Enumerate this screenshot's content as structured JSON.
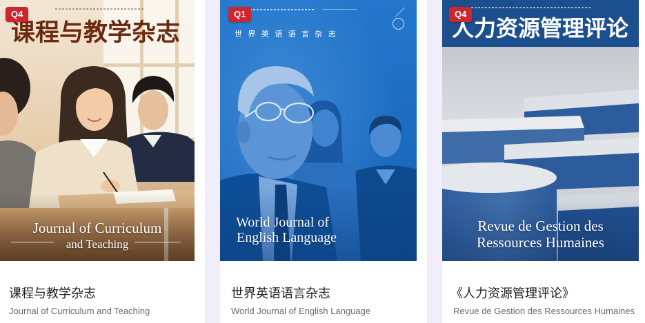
{
  "colors": {
    "page_background": "#efeefa",
    "card_background": "#ffffff",
    "badge_background": "#cc262f",
    "title_text": "#1f1f1f",
    "subtitle_text": "#6a6a6a"
  },
  "cards": [
    {
      "badge": "Q4",
      "cover": {
        "title_cn": "课程与教学杂志",
        "title_en_line1": "Journal of Curriculum",
        "title_en_line2": "and Teaching",
        "accent": "#6b2a0f"
      },
      "title": "课程与教学杂志",
      "subtitle": "Journal of Curriculum and Teaching"
    },
    {
      "badge": "Q1",
      "cover": {
        "title_cn": "世界英语语言杂志",
        "title_en_line1": "World Journal of",
        "title_en_line2": "English Language",
        "accent": "#1d6cc2"
      },
      "title": "世界英语语言杂志",
      "subtitle": "World Journal of English Language"
    },
    {
      "badge": "Q4",
      "cover": {
        "title_cn": "人力资源管理评论",
        "title_en_line1": "Revue de Gestion des",
        "title_en_line2": "Ressources Humaines",
        "accent": "#1c4f8d"
      },
      "title": "《人力资源管理评论》",
      "subtitle": "Revue de Gestion des Ressources Humaines"
    }
  ]
}
